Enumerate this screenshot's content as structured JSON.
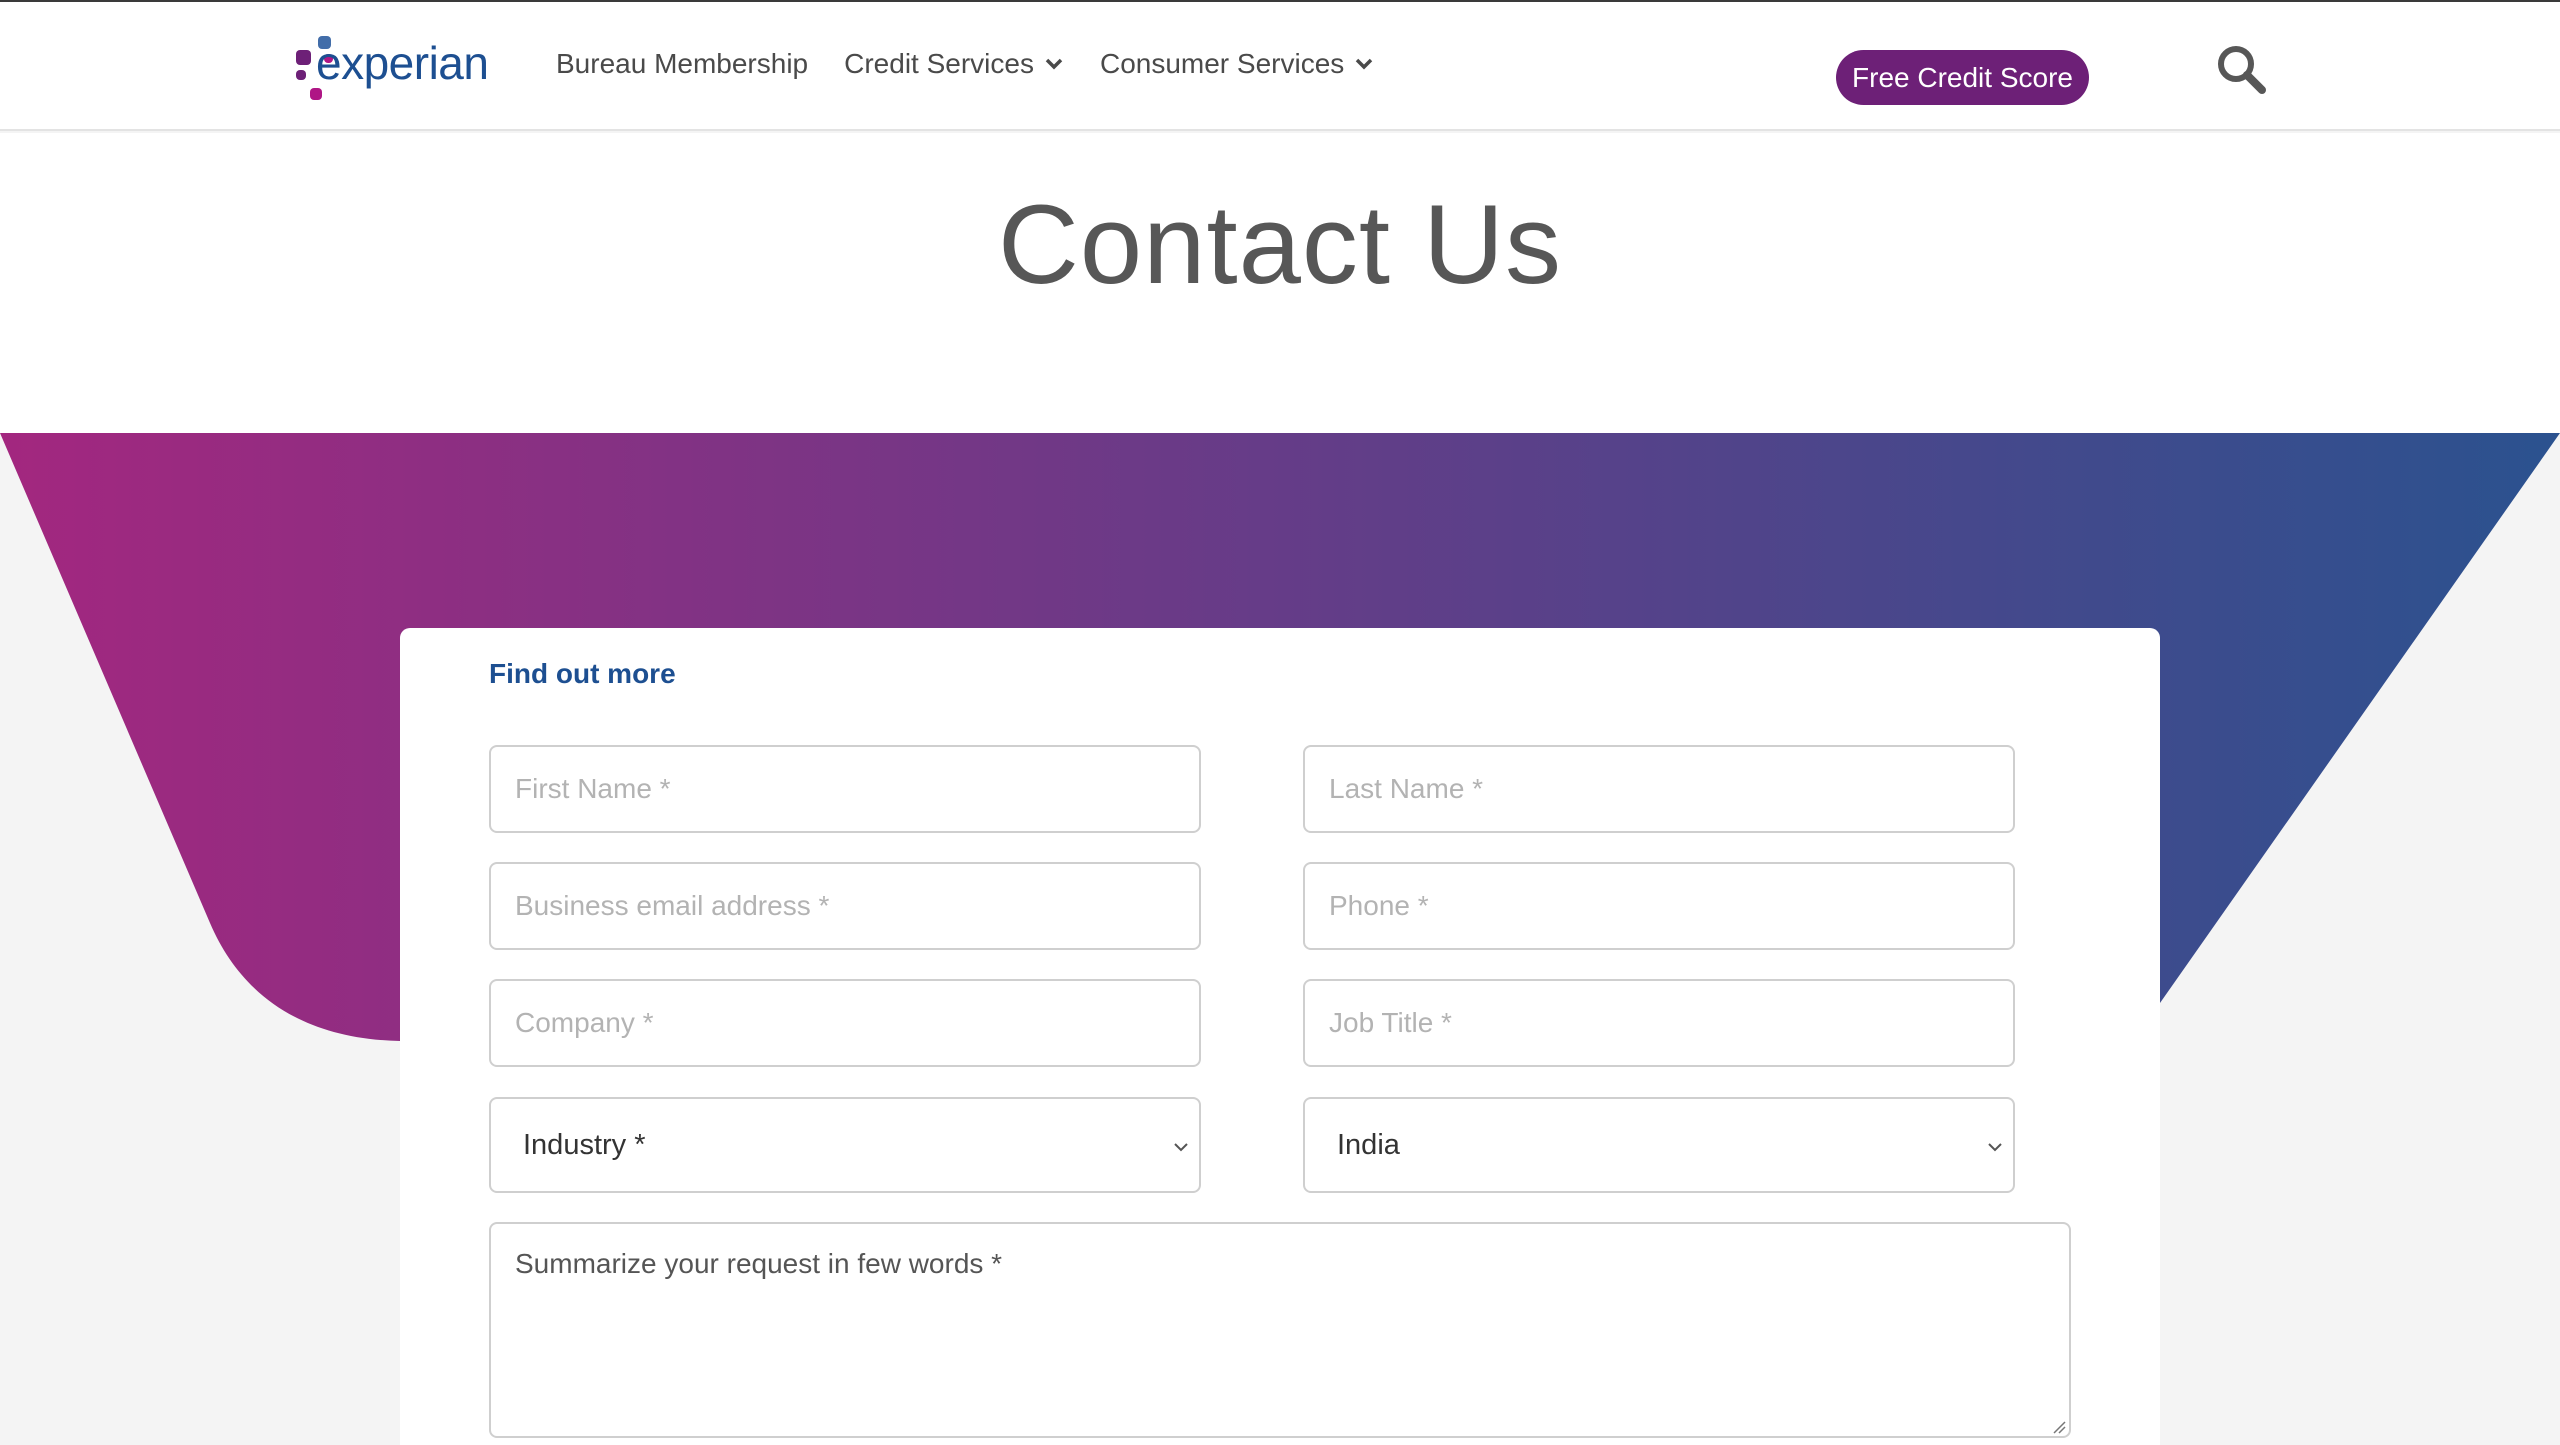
{
  "brand": {
    "logo_text": "experian",
    "logo_colors": [
      "#1d4f91",
      "#6d2077",
      "#af1685",
      "#426da9"
    ]
  },
  "nav": {
    "items": [
      {
        "label": "Bureau Membership",
        "has_dropdown": false
      },
      {
        "label": "Credit Services",
        "has_dropdown": true
      },
      {
        "label": "Consumer Services",
        "has_dropdown": true
      }
    ],
    "cta_label": "Free Credit Score",
    "search_icon": "search-icon"
  },
  "page": {
    "title": "Contact Us"
  },
  "form": {
    "heading": "Find out more",
    "fields": {
      "first_name": {
        "placeholder": "First Name *",
        "value": ""
      },
      "last_name": {
        "placeholder": "Last Name *",
        "value": ""
      },
      "email": {
        "placeholder": "Business email address *",
        "value": ""
      },
      "phone": {
        "placeholder": "Phone *",
        "value": ""
      },
      "company": {
        "placeholder": "Company *",
        "value": ""
      },
      "job_title": {
        "placeholder": "Job Title *",
        "value": ""
      },
      "industry": {
        "selected": "Industry *"
      },
      "country": {
        "selected": "India"
      },
      "request": {
        "placeholder": "Summarize your request in few words *",
        "value": ""
      }
    }
  },
  "colors": {
    "accent_purple": "#6d2077",
    "brand_blue": "#1d4f91",
    "gradient_start": "#a3277f",
    "gradient_end": "#2b528f"
  }
}
